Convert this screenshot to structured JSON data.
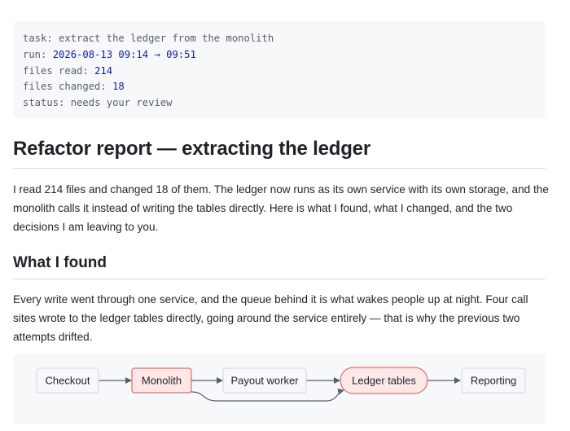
{
  "run_meta": [
    {
      "key": "task:",
      "value": "extract the ledger from the monolith",
      "plain": true
    },
    {
      "key": "run:",
      "value": "2026-08-13 09:14 → 09:51",
      "plain": false
    },
    {
      "key": "files read:",
      "value": "214",
      "plain": false
    },
    {
      "key": "files changed:",
      "value": "18",
      "plain": false
    },
    {
      "key": "status:",
      "value": "needs your review",
      "plain": true
    }
  ],
  "report": {
    "title": "Refactor report — extracting the ledger",
    "intro": "I read 214 files and changed 18 of them. The ledger now runs as its own service with its own storage, and the monolith calls it instead of writing the tables directly. Here is what I found, what I changed, and the two decisions I am leaving to you.",
    "found_heading": "What I found",
    "found_text": "Every write went through one service, and the queue behind it is what wakes people up at night. Four call sites wrote to the ledger tables directly, going around the service entirely — that is why the previous two attempts drifted."
  },
  "diagram": {
    "nodes": {
      "checkout": "Checkout",
      "monolith": "Monolith",
      "payout_worker": "Payout worker",
      "ledger_tables": "Ledger tables",
      "reporting": "Reporting"
    },
    "colors": {
      "highlight_fill": "#fde7e7",
      "highlight_stroke": "#d9534f",
      "node_fill": "#f6f8fa",
      "node_stroke": "#d0d7de",
      "edge": "#57606a"
    }
  }
}
